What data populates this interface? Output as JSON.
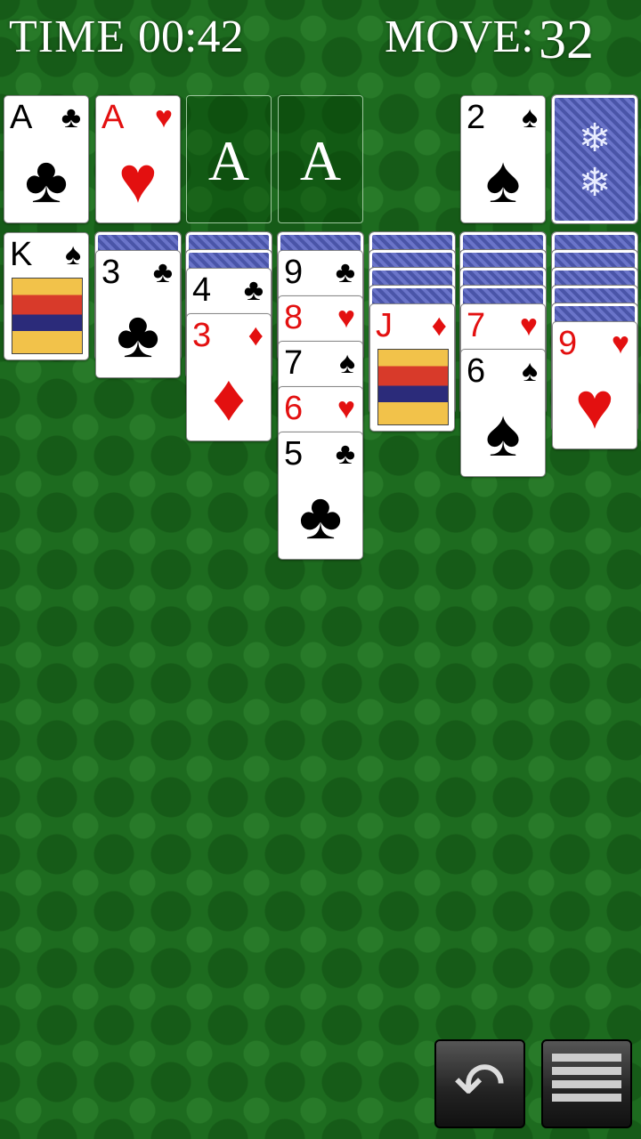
{
  "hud": {
    "time_label": "TIME",
    "time_value": "00:42",
    "move_label": "MOVE:",
    "move_value": "32"
  },
  "foundations": [
    {
      "rank": "A",
      "suit": "♣",
      "color": "black"
    },
    {
      "rank": "A",
      "suit": "♥",
      "color": "red"
    },
    {
      "empty_label": "A"
    },
    {
      "empty_label": "A"
    }
  ],
  "waste": {
    "rank": "2",
    "suit": "♠",
    "color": "black"
  },
  "stock": {
    "icon": "card-back-icon"
  },
  "tableau": [
    {
      "face_down": 0,
      "cards": [
        {
          "rank": "K",
          "suit": "♠",
          "color": "black",
          "face": true
        }
      ]
    },
    {
      "face_down": 1,
      "cards": [
        {
          "rank": "3",
          "suit": "♣",
          "color": "black"
        }
      ]
    },
    {
      "face_down": 2,
      "cards": [
        {
          "rank": "4",
          "suit": "♣",
          "color": "black"
        },
        {
          "rank": "3",
          "suit": "♦",
          "color": "red"
        }
      ]
    },
    {
      "face_down": 1,
      "cards": [
        {
          "rank": "9",
          "suit": "♣",
          "color": "black"
        },
        {
          "rank": "8",
          "suit": "♥",
          "color": "red"
        },
        {
          "rank": "7",
          "suit": "♠",
          "color": "black"
        },
        {
          "rank": "6",
          "suit": "♥",
          "color": "red"
        },
        {
          "rank": "5",
          "suit": "♣",
          "color": "black"
        }
      ]
    },
    {
      "face_down": 4,
      "cards": [
        {
          "rank": "J",
          "suit": "♦",
          "color": "red",
          "face": true
        }
      ]
    },
    {
      "face_down": 4,
      "cards": [
        {
          "rank": "7",
          "suit": "♥",
          "color": "red"
        },
        {
          "rank": "6",
          "suit": "♠",
          "color": "black"
        }
      ]
    },
    {
      "face_down": 5,
      "cards": [
        {
          "rank": "9",
          "suit": "♥",
          "color": "red"
        }
      ]
    }
  ],
  "controls": {
    "undo_icon": "undo-arrow-icon",
    "menu_icon": "menu-list-icon"
  }
}
